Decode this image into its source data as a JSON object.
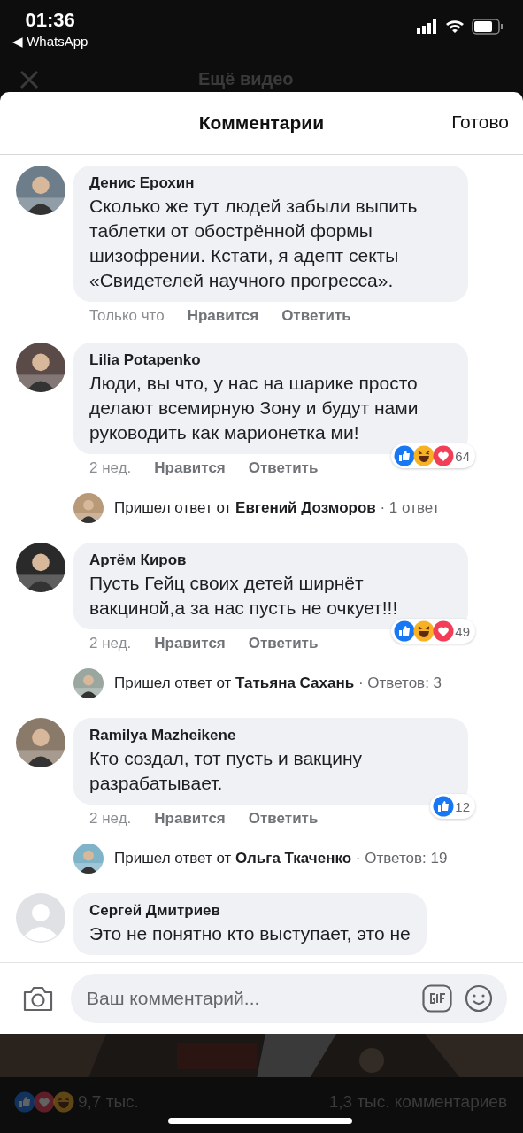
{
  "status_bar": {
    "time": "01:36",
    "back_app": "◀ WhatsApp"
  },
  "behind": {
    "title": "Ещё видео",
    "reaction_count": "9,7 тыс.",
    "comment_count": "1,3 тыс. комментариев",
    "reactions": [
      {
        "kind": "like"
      },
      {
        "kind": "love"
      },
      {
        "kind": "haha"
      }
    ]
  },
  "sheet": {
    "title": "Комментарии",
    "done": "Готово"
  },
  "comments": [
    {
      "author": "Денис Ерохин",
      "text": "Сколько же тут людей забыли выпить таблетки от обострённой формы шизофрении. Кстати, я адепт секты «Свидетелей научного прогресса».",
      "time": "Только что",
      "like": "Нравится",
      "reply": "Ответить"
    },
    {
      "author": "Lilia Potapenko",
      "text": "Люди, вы что, у нас на шарике просто делают всемирную Зону и будут нами руководить как марионетка ми!",
      "time": "2 нед.",
      "like": "Нравится",
      "reply": "Ответить",
      "reactions": [
        {
          "kind": "like"
        },
        {
          "kind": "haha"
        },
        {
          "kind": "love"
        }
      ],
      "reaction_count": "64",
      "replies": {
        "prefix": "Пришел ответ от",
        "name": "Евгений Дозморов",
        "count": "· 1 ответ"
      }
    },
    {
      "author": "Артём Киров",
      "text": "Пусть Гейц своих детей ширнёт вакциной,а за нас пусть не очкует!!!",
      "time": "2 нед.",
      "like": "Нравится",
      "reply": "Ответить",
      "reactions": [
        {
          "kind": "like"
        },
        {
          "kind": "haha"
        },
        {
          "kind": "love"
        }
      ],
      "reaction_count": "49",
      "replies": {
        "prefix": "Пришел ответ от",
        "name": "Татьяна Сахань",
        "count": "· Ответов: 3"
      }
    },
    {
      "author": "Ramilya Mazheikene",
      "text": "Кто создал, тот пусть и вакцину разрабатывает.",
      "time": "2 нед.",
      "like": "Нравится",
      "reply": "Ответить",
      "reactions": [
        {
          "kind": "like"
        }
      ],
      "reaction_count": "12",
      "replies": {
        "prefix": "Пришел ответ от",
        "name": "Ольга Ткаченко",
        "count": "· Ответов: 19"
      }
    },
    {
      "author": "Сергей Дмитриев",
      "text": "Это не понятно кто выступает, это не",
      "avatar": {
        "kind": "default"
      }
    }
  ],
  "composer": {
    "placeholder": "Ваш комментарий..."
  }
}
